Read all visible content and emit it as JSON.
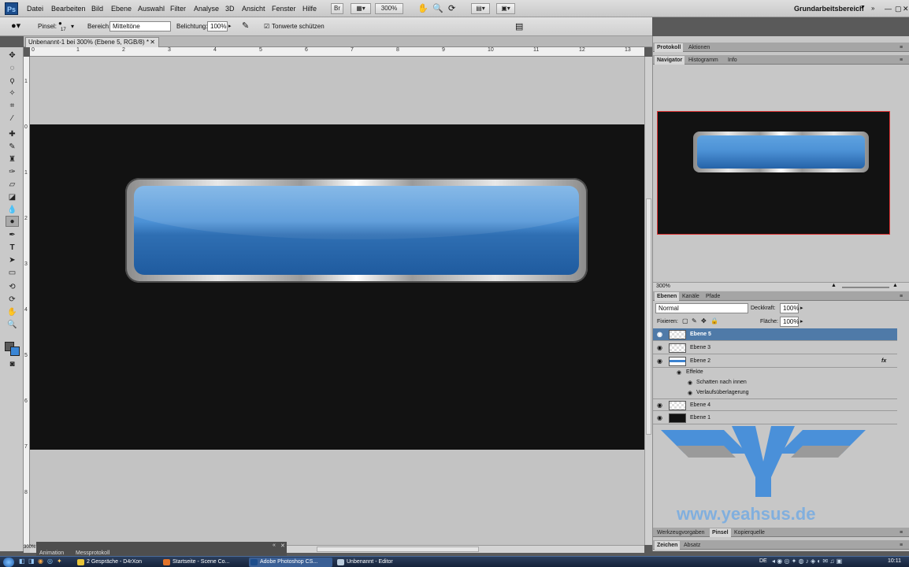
{
  "menubar": {
    "app_icon": "Ps",
    "items": [
      "Datei",
      "Bearbeiten",
      "Bild",
      "Ebene",
      "Auswahl",
      "Filter",
      "Analyse",
      "3D",
      "Ansicht",
      "Fenster",
      "Hilfe"
    ],
    "zoom": "300%",
    "workspace": "Grundarbeitsbereich",
    "bridge_label": "Br"
  },
  "options": {
    "tool_label": "Pinsel:",
    "brush_size": "17",
    "range_label": "Bereich:",
    "range_value": "Mitteltöne",
    "exposure_label": "Belichtung:",
    "exposure_value": "100%",
    "protect_label": "Tonwerte schützen"
  },
  "document": {
    "tab_title": "Unbenannt-1 bei 300% (Ebene 5, RGB/8) *",
    "ruler_h": [
      "0",
      "1",
      "2",
      "3",
      "4",
      "5",
      "6",
      "7",
      "8",
      "9",
      "10",
      "11",
      "12",
      "13"
    ],
    "ruler_v": [
      "1",
      "0",
      "1",
      "2",
      "3",
      "4",
      "5",
      "6",
      "7",
      "8"
    ],
    "status_zoom": "300%"
  },
  "bottom_panel": {
    "tabs": [
      "Animation",
      "Messprotokoll"
    ]
  },
  "right": {
    "top_tabs": [
      "Protokoll",
      "Aktionen"
    ],
    "nav_tabs": [
      "Navigator",
      "Histogramm",
      "Info"
    ],
    "nav_zoom": "300%",
    "layers_tabs": [
      "Ebenen",
      "Kanäle",
      "Pfade"
    ],
    "blend_mode": "Normal",
    "opacity_label": "Deckkraft:",
    "opacity_value": "100%",
    "lock_label": "Fixieren:",
    "fill_label": "Fläche:",
    "fill_value": "100%",
    "layers": [
      {
        "name": "Ebene 5",
        "selected": true
      },
      {
        "name": "Ebene 3",
        "selected": false
      },
      {
        "name": "Ebene 2",
        "selected": false,
        "fx": "fx"
      },
      {
        "name": "Ebene 4",
        "selected": false
      },
      {
        "name": "Ebene 1",
        "selected": false
      }
    ],
    "effects_label": "Effekte",
    "effects": [
      "Schatten nach innen",
      "Verlaufsüberlagerung"
    ],
    "watermark": "www.yeahsus.de",
    "lower_tabs1": [
      "Werkzeugvorgaben",
      "Pinsel",
      "Kopierquelle"
    ],
    "lower_tabs2": [
      "Zeichen",
      "Absatz"
    ]
  },
  "taskbar": {
    "items": [
      "2 Gespräche - D4rXon",
      "Startseite - Scene Co...",
      "Adobe Photoshop CS...",
      "Unbenannt - Editor"
    ],
    "lang": "DE",
    "clock": "10:11"
  },
  "colors": {
    "accent": "#4f7aa8",
    "button_blue": "#4d92d6",
    "canvas_dark": "#121212"
  }
}
